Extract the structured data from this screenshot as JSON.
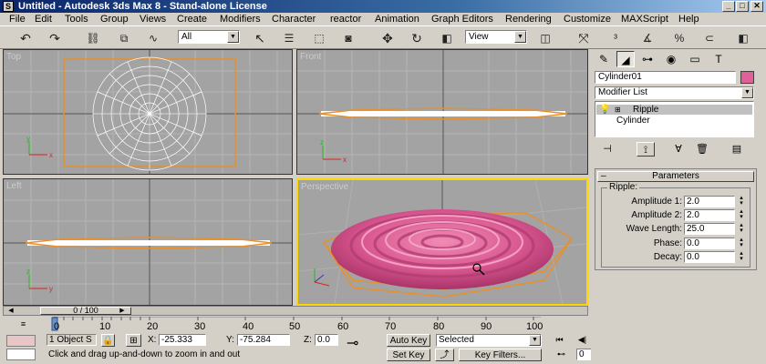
{
  "window": {
    "app_icon": "3ds-max-icon",
    "title": "Untitled - Autodesk 3ds Max 8 - Stand-alone License",
    "controls": [
      "minimize-icon",
      "maximize-icon",
      "close-icon"
    ]
  },
  "menu": [
    "File",
    "Edit",
    "Tools",
    "Group",
    "Views",
    "Create",
    "Modifiers",
    "Character",
    "reactor",
    "Animation",
    "Graph Editors",
    "Rendering",
    "Customize",
    "MAXScript",
    "Help"
  ],
  "toolbar": {
    "selection_filter": "All",
    "ref_coord": "View"
  },
  "viewports": {
    "top_label": "Top",
    "front_label": "Front",
    "left_label": "Left",
    "persp_label": "Perspective",
    "grid_color": "#b0b0b0",
    "bg_color": "#a3a3a3",
    "active_border": "#ffd700",
    "object_color": "#e0609a"
  },
  "time": {
    "slider_label": "0 / 100"
  },
  "trackbar": {
    "ticks": [
      "0",
      "10",
      "20",
      "30",
      "40",
      "50",
      "60",
      "70",
      "80",
      "90",
      "100"
    ]
  },
  "status": {
    "selection_count": "1 Object S",
    "x_label": "X:",
    "x_value": "-25.333",
    "y_label": "Y:",
    "y_value": "-75.284",
    "z_label": "Z:",
    "z_value": "0.0",
    "prompt": "Click and drag up-and-down to zoom in and out",
    "auto_key": "Auto Key",
    "set_key": "Set Key",
    "key_mode": "Selected",
    "key_filters": "Key Filters...",
    "frame": "0"
  },
  "command_panel": {
    "object_name": "Cylinder01",
    "object_color": "#e0609a",
    "modifier_list": "Modifier List",
    "stack": [
      "Ripple",
      "Cylinder"
    ],
    "rollout_title": "Parameters",
    "group_title": "Ripple:",
    "params": [
      {
        "label": "Amplitude 1:",
        "value": "2.0"
      },
      {
        "label": "Amplitude 2:",
        "value": "2.0"
      },
      {
        "label": "Wave Length:",
        "value": "25.0"
      },
      {
        "label": "Phase:",
        "value": "0.0"
      },
      {
        "label": "Decay:",
        "value": "0.0"
      }
    ]
  }
}
